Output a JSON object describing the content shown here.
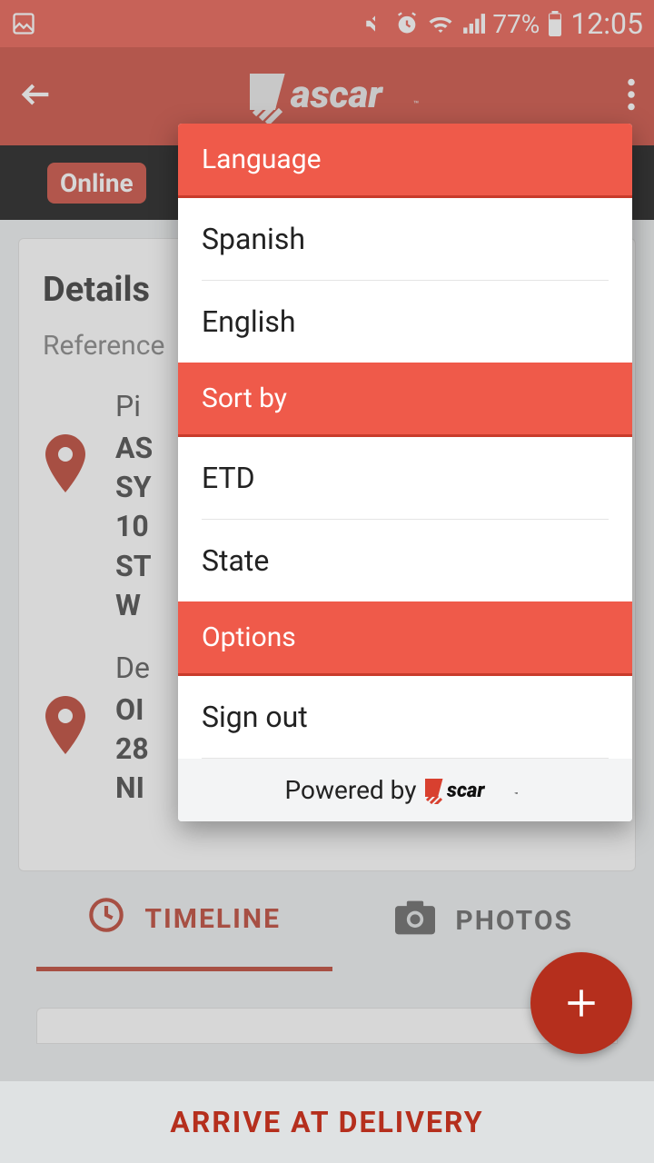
{
  "statusbar": {
    "battery_pct": "77%",
    "time": "12:05"
  },
  "appbar": {
    "title_alt": "ascar"
  },
  "strip": {
    "online_label": "Online"
  },
  "card": {
    "title": "Details",
    "reference_label": "Reference",
    "pickup": {
      "label": "Pi",
      "l1": "AS",
      "l2": "SY",
      "l3": "10",
      "l4": "ST",
      "l5": "W"
    },
    "delivery": {
      "label": "De",
      "l1": "OI",
      "l2": "28",
      "l3": "NI"
    }
  },
  "tabs": {
    "timeline": "TIMELINE",
    "photos": "PHOTOS"
  },
  "bottom": {
    "action": "ARRIVE AT DELIVERY"
  },
  "menu": {
    "language_header": "Language",
    "spanish": "Spanish",
    "english": "English",
    "sortby_header": "Sort by",
    "etd": "ETD",
    "state": "State",
    "options_header": "Options",
    "signout": "Sign out",
    "powered_by": "Powered by"
  }
}
